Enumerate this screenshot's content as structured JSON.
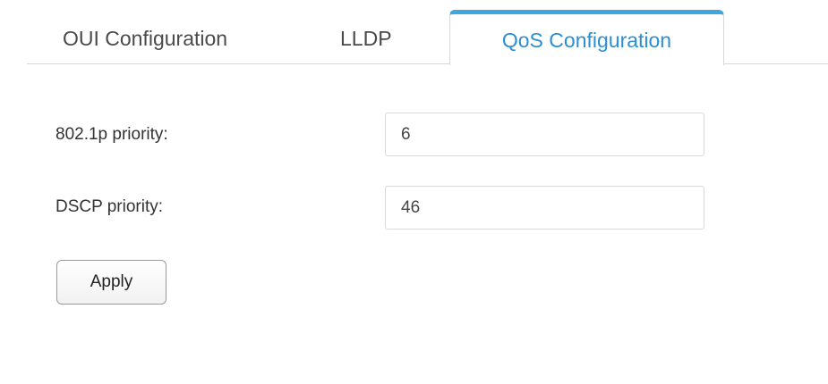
{
  "tabs": [
    {
      "label": "OUI Configuration",
      "active": false
    },
    {
      "label": "LLDP",
      "active": false
    },
    {
      "label": "QoS Configuration",
      "active": true
    }
  ],
  "qos": {
    "priority_8021p": {
      "label": "802.1p priority:",
      "value": "6"
    },
    "dscp_priority": {
      "label": "DSCP priority:",
      "value": "46"
    },
    "apply_label": "Apply"
  },
  "colors": {
    "active_tab_text": "#2b8fd1",
    "active_tab_border": "#3da7e0",
    "inactive_tab_text": "#4a4a4a",
    "label_text": "#333333"
  }
}
